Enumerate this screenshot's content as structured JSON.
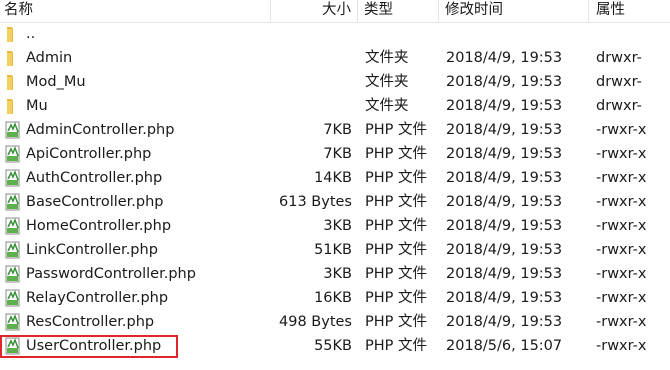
{
  "header": {
    "name": "名称",
    "size": "大小",
    "type": "类型",
    "modified": "修改时间",
    "attributes": "属性"
  },
  "colors": {
    "folder": "#e8b93a",
    "php_icon_green": "#5bb24a",
    "highlight": "#e0262b"
  },
  "rows": [
    {
      "name": "..",
      "size": "",
      "type": "",
      "modified": "",
      "perm": "",
      "icon": "folder-icon"
    },
    {
      "name": "Admin",
      "size": "",
      "type": "文件夹",
      "modified": "2018/4/9, 19:53",
      "perm": "drwxr-",
      "icon": "folder-icon"
    },
    {
      "name": "Mod_Mu",
      "size": "",
      "type": "文件夹",
      "modified": "2018/4/9, 19:53",
      "perm": "drwxr-",
      "icon": "folder-icon"
    },
    {
      "name": "Mu",
      "size": "",
      "type": "文件夹",
      "modified": "2018/4/9, 19:53",
      "perm": "drwxr-",
      "icon": "folder-icon"
    },
    {
      "name": "AdminController.php",
      "size": "7KB",
      "type": "PHP 文件",
      "modified": "2018/4/9, 19:53",
      "perm": "-rwxr-x",
      "icon": "php-file-icon"
    },
    {
      "name": "ApiController.php",
      "size": "7KB",
      "type": "PHP 文件",
      "modified": "2018/4/9, 19:53",
      "perm": "-rwxr-x",
      "icon": "php-file-icon"
    },
    {
      "name": "AuthController.php",
      "size": "14KB",
      "type": "PHP 文件",
      "modified": "2018/4/9, 19:53",
      "perm": "-rwxr-x",
      "icon": "php-file-icon"
    },
    {
      "name": "BaseController.php",
      "size": "613 Bytes",
      "type": "PHP 文件",
      "modified": "2018/4/9, 19:53",
      "perm": "-rwxr-x",
      "icon": "php-file-icon"
    },
    {
      "name": "HomeController.php",
      "size": "3KB",
      "type": "PHP 文件",
      "modified": "2018/4/9, 19:53",
      "perm": "-rwxr-x",
      "icon": "php-file-icon"
    },
    {
      "name": "LinkController.php",
      "size": "51KB",
      "type": "PHP 文件",
      "modified": "2018/4/9, 19:53",
      "perm": "-rwxr-x",
      "icon": "php-file-icon"
    },
    {
      "name": "PasswordController.php",
      "size": "3KB",
      "type": "PHP 文件",
      "modified": "2018/4/9, 19:53",
      "perm": "-rwxr-x",
      "icon": "php-file-icon"
    },
    {
      "name": "RelayController.php",
      "size": "16KB",
      "type": "PHP 文件",
      "modified": "2018/4/9, 19:53",
      "perm": "-rwxr-x",
      "icon": "php-file-icon"
    },
    {
      "name": "ResController.php",
      "size": "498 Bytes",
      "type": "PHP 文件",
      "modified": "2018/4/9, 19:53",
      "perm": "-rwxr-x",
      "icon": "php-file-icon"
    },
    {
      "name": "UserController.php",
      "size": "55KB",
      "type": "PHP 文件",
      "modified": "2018/5/6, 15:07",
      "perm": "-rwxr-x",
      "icon": "php-file-icon",
      "highlighted": true
    }
  ]
}
